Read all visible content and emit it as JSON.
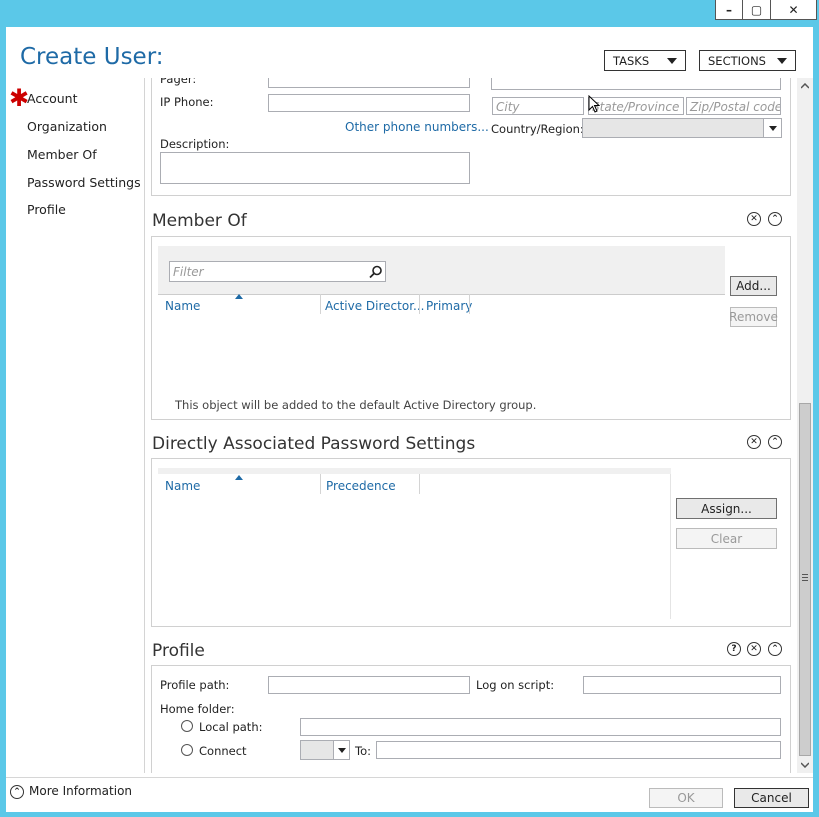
{
  "window": {
    "minimize": "–",
    "maximize": "▢",
    "close": "✕"
  },
  "header": {
    "title": "Create User:",
    "tasks_label": "TASKS",
    "sections_label": "SECTIONS"
  },
  "nav": {
    "required_mark": "✱",
    "items": [
      "Account",
      "Organization",
      "Member Of",
      "Password Settings",
      "Profile"
    ]
  },
  "contact": {
    "pager_label": "Pager:",
    "ip_phone_label": "IP Phone:",
    "other_phone_link": "Other phone numbers...",
    "description_label": "Description:",
    "city_placeholder": "City",
    "state_placeholder": "State/Province",
    "zip_placeholder": "Zip/Postal code",
    "country_label": "Country/Region:"
  },
  "member_of": {
    "title": "Member Of",
    "filter_placeholder": "Filter",
    "columns": [
      "Name",
      "Active Director...",
      "Primary"
    ],
    "note": "This object will be added to the default Active Directory group.",
    "add_label": "Add...",
    "remove_label": "Remove"
  },
  "password_settings": {
    "title": "Directly Associated Password Settings",
    "columns": [
      "Name",
      "Precedence"
    ],
    "assign_label": "Assign...",
    "clear_label": "Clear"
  },
  "profile": {
    "title": "Profile",
    "profile_path_label": "Profile path:",
    "logon_script_label": "Log on script:",
    "home_folder_label": "Home folder:",
    "local_path_label": "Local path:",
    "connect_label": "Connect",
    "to_label": "To:"
  },
  "footer": {
    "more_info": "More Information",
    "ok_label": "OK",
    "cancel_label": "Cancel"
  },
  "colors": {
    "accent": "#1e6aa6",
    "chrome": "#5bc8e8",
    "required": "#cc0000"
  }
}
